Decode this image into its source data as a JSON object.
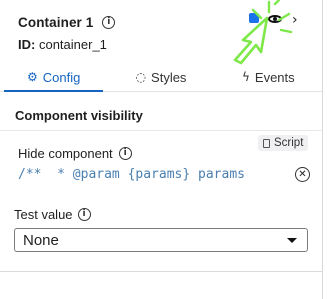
{
  "header": {
    "title": "Container 1",
    "id_label": "ID:",
    "id_value": "container_1"
  },
  "tabs": [
    {
      "label": "Config",
      "icon": "gear-icon",
      "active": true
    },
    {
      "label": "Styles",
      "icon": "palette-icon",
      "active": false
    },
    {
      "label": "Events",
      "icon": "lightning-icon",
      "active": false
    }
  ],
  "section": {
    "title": "Component visibility"
  },
  "hide_component": {
    "label": "Hide component",
    "script_button": "Script",
    "code": "/**  * @param {params} params"
  },
  "test_value": {
    "label": "Test value",
    "selected": "None"
  },
  "colors": {
    "accent": "#1565c0",
    "cursor_highlight": "#7ee84a"
  }
}
